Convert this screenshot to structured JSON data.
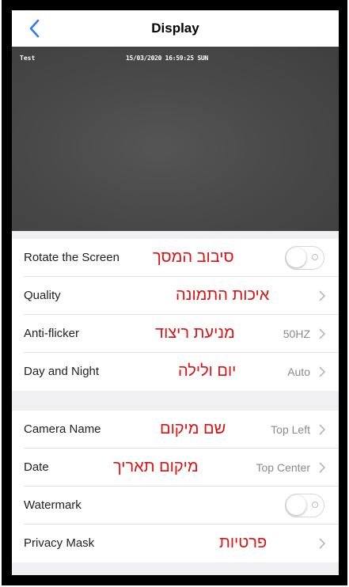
{
  "header": {
    "title": "Display"
  },
  "video": {
    "osd_name": "Test",
    "osd_datetime": "15/03/2020 16:59:25 SUN"
  },
  "group1": {
    "rows": [
      {
        "label": "Rotate the Screen",
        "annotation": "סיבוב המסך",
        "type": "toggle",
        "checked": false
      },
      {
        "label": "Quality",
        "annotation": "איכות התמונה",
        "type": "link",
        "value": ""
      },
      {
        "label": "Anti-flicker",
        "annotation": "מניעת ריצוד",
        "type": "link",
        "value": "50HZ"
      },
      {
        "label": "Day and Night",
        "annotation": "יום ולילה",
        "type": "link",
        "value": "Auto"
      }
    ]
  },
  "group2": {
    "rows": [
      {
        "label": "Camera Name",
        "annotation": "שם מיקום",
        "type": "link",
        "value": "Top Left"
      },
      {
        "label": "Date",
        "annotation": "מיקום תאריך",
        "type": "link",
        "value": "Top Center"
      },
      {
        "label": "Watermark",
        "annotation": "",
        "type": "toggle",
        "checked": false
      },
      {
        "label": "Privacy Mask",
        "annotation": "פרטיות",
        "type": "link",
        "value": ""
      }
    ]
  },
  "colors": {
    "accent": "#2f7cf6",
    "annotation": "#e01010",
    "background": "#f0f0f2"
  },
  "icons": {
    "back": "chevron-left-icon",
    "row_arrow": "chevron-right-icon"
  }
}
